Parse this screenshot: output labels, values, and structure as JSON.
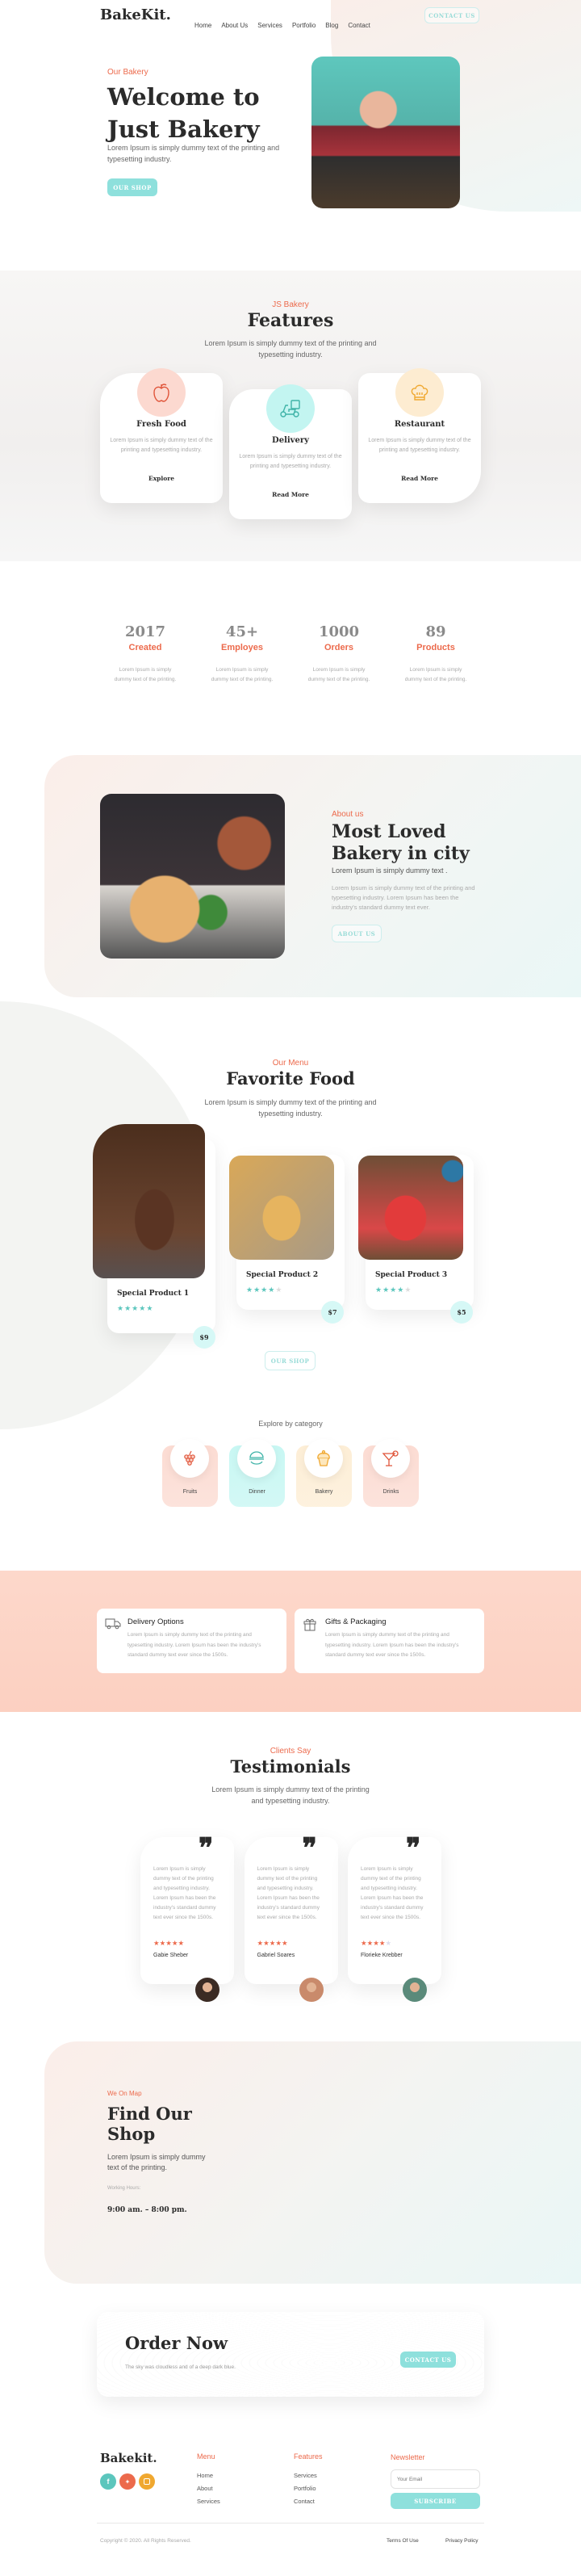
{
  "brand": {
    "logo": "BakeKit.",
    "accent": "#ec6a4c",
    "teal": "#8ee0dc"
  },
  "nav": {
    "items": [
      "Home",
      "About Us",
      "Services",
      "Portfolio",
      "Blog",
      "Contact"
    ],
    "cta": "CONTACT US"
  },
  "hero": {
    "eyebrow": "Our Bakery",
    "title_line1": "Welcome to",
    "title_line2": "Just Bakery",
    "text": "Lorem Ipsum is simply dummy text of the printing and typesetting industry.",
    "button": "OUR SHOP"
  },
  "features": {
    "eyebrow": "JS Bakery",
    "title": "Features",
    "text": "Lorem Ipsum is simply dummy text of the printing and typesetting industry.",
    "cards": [
      {
        "icon": "apple-icon",
        "title": "Fresh Food",
        "text": "Lorem Ipsum is simply dummy text of the printing and typesetting industry.",
        "link": "Explore"
      },
      {
        "icon": "delivery-scooter-icon",
        "title": "Delivery",
        "text": "Lorem Ipsum is simply dummy text of the printing and typesetting industry.",
        "link": "Read More"
      },
      {
        "icon": "chef-hat-icon",
        "title": "Restaurant",
        "text": "Lorem Ipsum is simply dummy text of the printing and typesetting industry.",
        "link": "Read More"
      }
    ]
  },
  "stats": [
    {
      "value": "2017",
      "label": "Created",
      "text": "Lorem Ipsum is simply dummy text of the printing."
    },
    {
      "value": "45+",
      "label": "Employes",
      "text": "Lorem Ipsum is simply dummy text of the printing."
    },
    {
      "value": "1000",
      "label": "Orders",
      "text": "Lorem Ipsum is simply dummy text of the printing."
    },
    {
      "value": "89",
      "label": "Products",
      "text": "Lorem Ipsum is simply dummy text of the printing."
    }
  ],
  "about": {
    "eyebrow": "About us",
    "title_line1": "Most Loved",
    "title_line2": "Bakery in city",
    "subtitle": "Lorem Ipsum is simply dummy text .",
    "text": "Lorem Ipsum is simply dummy text of the printing and typesetting industry. Lorem Ipsum has been the industry's standard dummy text ever.",
    "button": "ABOUT US"
  },
  "menu": {
    "eyebrow": "Our Menu",
    "title": "Favorite Food",
    "text": "Lorem Ipsum is simply dummy text of the printing and typesetting industry.",
    "products": [
      {
        "name": "Special Product 1",
        "rating": 5,
        "price": "$9"
      },
      {
        "name": "Special Product 2",
        "rating": 4,
        "price": "$7"
      },
      {
        "name": "Special Product 3",
        "rating": 4,
        "price": "$5"
      }
    ],
    "button": "OUR SHOP",
    "explore_label": "Explore by category",
    "categories": [
      {
        "label": "Fruits",
        "icon": "grapes-icon"
      },
      {
        "label": "Dinner",
        "icon": "burger-icon"
      },
      {
        "label": "Bakery",
        "icon": "cupcake-icon"
      },
      {
        "label": "Drinks",
        "icon": "cocktail-icon"
      }
    ]
  },
  "services": [
    {
      "icon": "truck-icon",
      "title": "Delivery Options",
      "text": "Lorem Ipsum is simply dummy text of the printing and typesetting industry. Lorem Ipsum has been the industry's standard dummy text ever since the 1500s."
    },
    {
      "icon": "gift-icon",
      "title": "Gifts & Packaging",
      "text": "Lorem Ipsum is simply dummy text of the printing and typesetting industry. Lorem Ipsum has been the industry's standard dummy text ever since the 1500s."
    }
  ],
  "testimonials": {
    "eyebrow": "Clients Say",
    "title": "Testimonials",
    "text": "Lorem Ipsum is simply dummy text of the printing and typesetting industry.",
    "items": [
      {
        "text": "Lorem Ipsum is simply dummy text of the printing and typesetting industry. Lorem Ipsum has been the industry's standard dummy text ever since the 1500s.",
        "rating": 5,
        "stars": "★★★★★",
        "name": "Gabie Sheber"
      },
      {
        "text": "Lorem Ipsum is simply dummy text of the printing and typesetting industry. Lorem Ipsum has been the industry's standard dummy text ever since the 1500s.",
        "rating": 4.5,
        "stars": "★★★★★",
        "name": "Gabriel Soares"
      },
      {
        "text": "Lorem Ipsum is simply dummy text of the printing and typesetting industry. Lorem Ipsum has been the industry's standard dummy text ever since the 1500s.",
        "rating": 4,
        "stars": "★★★★",
        "name": "Florieke Krebber"
      }
    ]
  },
  "map": {
    "eyebrow": "We On Map",
    "title_line1": "Find Our",
    "title_line2": "Shop",
    "text": "Lorem Ipsum is simply dummy text of the printing.",
    "hours_label": "Working Hours:",
    "hours": "9:00 am. – 8:00 pm."
  },
  "order": {
    "title": "Order Now",
    "text": "The sky was cloudless and of a deep dark blue.",
    "button": "CONTACT US"
  },
  "footer": {
    "logo": "Bakekit.",
    "social": [
      "facebook-icon",
      "twitter-icon",
      "instagram-icon"
    ],
    "menu_title": "Menu",
    "menu": [
      "Home",
      "About",
      "Services"
    ],
    "features_title": "Features",
    "features": [
      "Services",
      "Portfolio",
      "Contact"
    ],
    "newsletter_title": "Newsletter",
    "email_placeholder": "Your Email",
    "subscribe": "SUBSCRIBE",
    "copyright": "Copyright © 2020. All Rights Reserved.",
    "terms": "Terms Of Use",
    "privacy": "Privacy Policy"
  }
}
